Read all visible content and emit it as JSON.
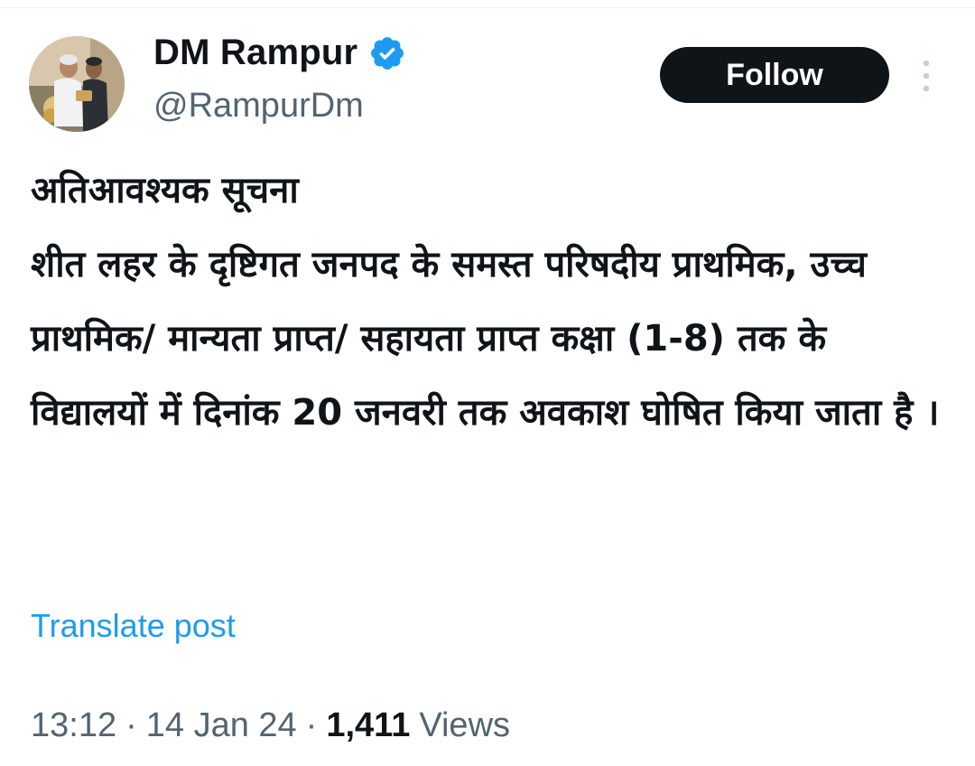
{
  "author": {
    "display_name": "DM Rampur",
    "handle": "@RampurDm",
    "verified": true
  },
  "actions": {
    "follow_label": "Follow"
  },
  "post": {
    "text": "अतिआवश्यक सूचना\nशीत लहर के दृष्टिगत जनपद के समस्त परिषदीय प्राथमिक, उच्च प्राथमिक/ मान्यता प्राप्त/ सहायता प्राप्त कक्षा (1-8) तक के विद्यालयों में दिनांक 20 जनवरी तक अवकाश घोषित किया जाता है ।",
    "translate_label": "Translate post"
  },
  "meta": {
    "time": "13:12",
    "separator": "·",
    "date": "14 Jan 24",
    "views_count": "1,411",
    "views_label": "Views"
  },
  "colors": {
    "link": "#1d9bf0",
    "secondary_text": "#536471",
    "primary_text": "#0f1419",
    "follow_button_bg": "#0f1419",
    "verified_badge": "#1d9bf0"
  },
  "icons": {
    "verified": "verified-badge-icon",
    "more": "more-options-icon"
  }
}
